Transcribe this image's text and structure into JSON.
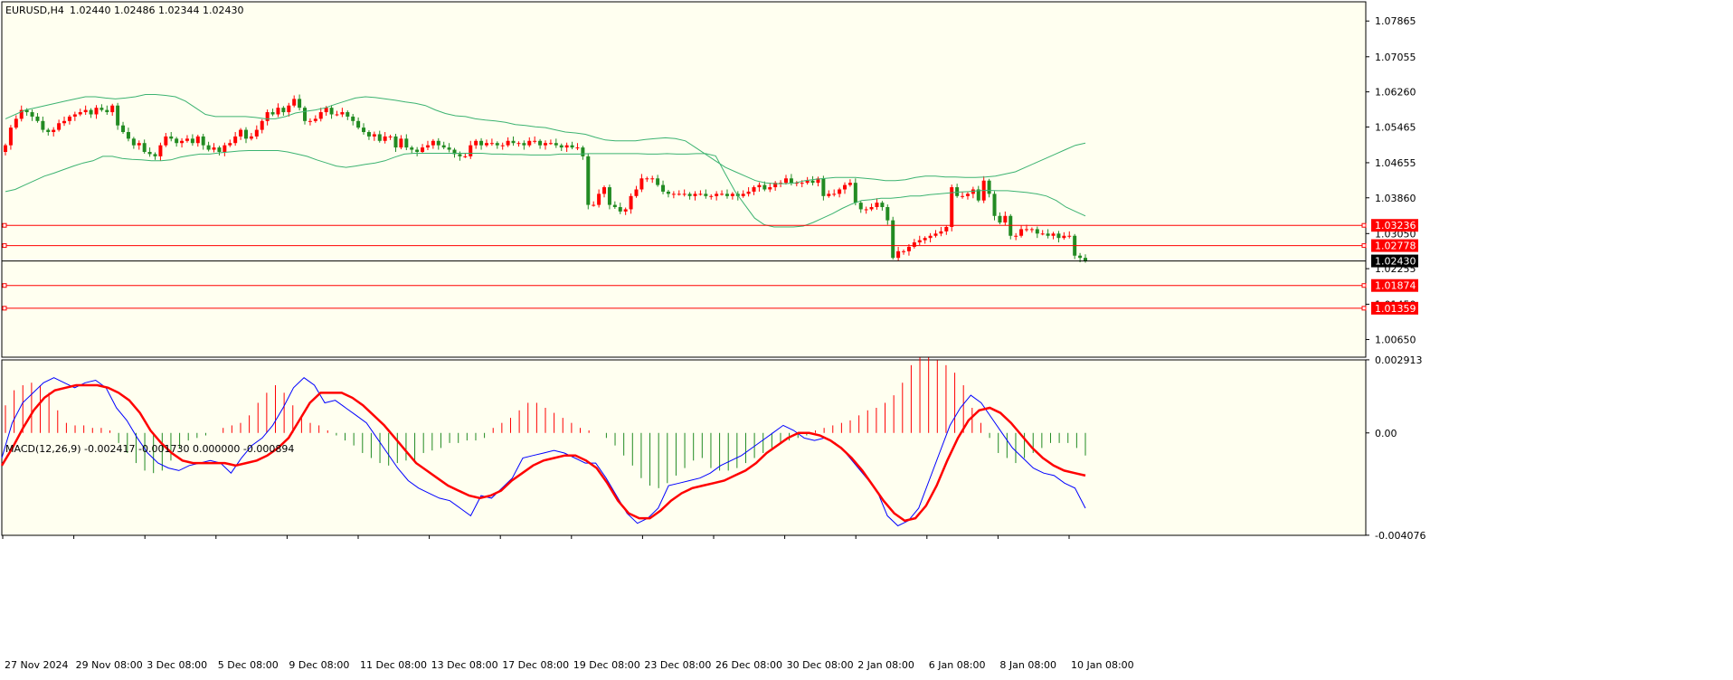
{
  "header": {
    "symbol": "EURUSD,H4",
    "ohlc": "1.02440 1.02486 1.02344 1.02430"
  },
  "macd_header": "MACD(12,26,9) -0.002417 -0.001730 0.000000 -0.000894",
  "colors": {
    "background": "#fffff0",
    "bull": "#ff0000",
    "bear": "#228b22",
    "bands": "#3cb371",
    "macd_line": "#0000ff",
    "signal_line": "#ff0000",
    "hline": "#ff0000",
    "current_line": "#000000"
  },
  "chart_data": [
    {
      "type": "candlestick",
      "title": "EURUSD,H4",
      "ylim": [
        1.0025,
        1.083
      ],
      "y_ticks": [
        "1.07865",
        "1.07055",
        "1.06260",
        "1.05465",
        "1.04655",
        "1.03860",
        "1.03050",
        "1.02255",
        "1.01450",
        "1.00650"
      ],
      "x_ticks": [
        "27 Nov 2024",
        "29 Nov 08:00",
        "3 Dec 08:00",
        "5 Dec 08:00",
        "9 Dec 08:00",
        "11 Dec 08:00",
        "13 Dec 08:00",
        "17 Dec 08:00",
        "19 Dec 08:00",
        "23 Dec 08:00",
        "26 Dec 08:00",
        "30 Dec 08:00",
        "2 Jan 08:00",
        "6 Jan 08:00",
        "8 Jan 08:00",
        "10 Jan 08:00"
      ],
      "last_price": "1.02430",
      "horizontal_levels": [
        "1.03236",
        "1.02778",
        "1.01874",
        "1.01359"
      ],
      "close_series": [
        1.0505,
        1.0545,
        1.0565,
        1.0585,
        1.058,
        1.057,
        1.056,
        1.054,
        1.0535,
        1.054,
        1.0555,
        1.056,
        1.057,
        1.0575,
        1.058,
        1.0585,
        1.0575,
        1.059,
        1.0585,
        1.058,
        1.0595,
        1.055,
        1.0535,
        1.052,
        1.0505,
        1.051,
        1.049,
        1.0485,
        1.048,
        1.0505,
        1.0525,
        1.052,
        1.051,
        1.0515,
        1.052,
        1.051,
        1.0525,
        1.0505,
        1.0495,
        1.05,
        1.049,
        1.0505,
        1.051,
        1.0525,
        1.054,
        1.052,
        1.0525,
        1.054,
        1.056,
        1.058,
        1.0575,
        1.059,
        1.058,
        1.0595,
        1.061,
        1.059,
        1.056,
        1.056,
        1.0565,
        1.058,
        1.059,
        1.0575,
        1.0575,
        1.058,
        1.057,
        1.056,
        1.0545,
        1.0535,
        1.0525,
        1.053,
        1.0515,
        1.0525,
        1.0525,
        1.05,
        1.052,
        1.05,
        1.0495,
        1.049,
        1.05,
        1.0505,
        1.0515,
        1.0505,
        1.05,
        1.0495,
        1.0485,
        1.048,
        1.048,
        1.0505,
        1.0515,
        1.0505,
        1.051,
        1.051,
        1.0505,
        1.0505,
        1.0515,
        1.051,
        1.051,
        1.0505,
        1.0515,
        1.0515,
        1.0505,
        1.051,
        1.051,
        1.0505,
        1.05,
        1.0505,
        1.05,
        1.05,
        1.048,
        1.037,
        1.037,
        1.0395,
        1.041,
        1.037,
        1.0365,
        1.0355,
        1.036,
        1.039,
        1.0405,
        1.043,
        1.043,
        1.043,
        1.0415,
        1.04,
        1.0395,
        1.0395,
        1.0395,
        1.0395,
        1.039,
        1.0395,
        1.0395,
        1.039,
        1.039,
        1.0395,
        1.0395,
        1.039,
        1.0395,
        1.039,
        1.0395,
        1.04,
        1.041,
        1.0415,
        1.0405,
        1.041,
        1.042,
        1.042,
        1.043,
        1.042,
        1.042,
        1.042,
        1.0425,
        1.042,
        1.043,
        1.039,
        1.0395,
        1.0395,
        1.0405,
        1.0415,
        1.042,
        1.0375,
        1.036,
        1.036,
        1.0365,
        1.0375,
        1.0365,
        1.0335,
        1.025,
        1.0265,
        1.0265,
        1.0275,
        1.0285,
        1.029,
        1.0295,
        1.03,
        1.0305,
        1.031,
        1.032,
        1.041,
        1.039,
        1.039,
        1.0395,
        1.0405,
        1.038,
        1.0425,
        1.0395,
        1.0345,
        1.033,
        1.0345,
        1.03,
        1.03,
        1.0315,
        1.0315,
        1.0315,
        1.0305,
        1.0305,
        1.03,
        1.0305,
        1.0295,
        1.03,
        1.03,
        1.0255,
        1.025,
        1.0243
      ],
      "band_upper": [
        1.0565,
        1.0575,
        1.0585,
        1.059,
        1.0595,
        1.06,
        1.0605,
        1.061,
        1.0615,
        1.0615,
        1.0612,
        1.061,
        1.0612,
        1.0615,
        1.062,
        1.062,
        1.0618,
        1.0615,
        1.0605,
        1.059,
        1.0575,
        1.057,
        1.057,
        1.057,
        1.057,
        1.0568,
        1.0565,
        1.0565,
        1.057,
        1.0578,
        1.0582,
        1.0585,
        1.059,
        1.0598,
        1.0605,
        1.0612,
        1.0615,
        1.0613,
        1.061,
        1.0607,
        1.0603,
        1.06,
        1.0595,
        1.0585,
        1.0577,
        1.0572,
        1.057,
        1.0565,
        1.0562,
        1.056,
        1.0557,
        1.0552,
        1.055,
        1.0547,
        1.0545,
        1.054,
        1.0535,
        1.0533,
        1.053,
        1.0523,
        1.0517,
        1.0515,
        1.0515,
        1.0515,
        1.0518,
        1.052,
        1.0522,
        1.052,
        1.0515,
        1.05,
        1.0485,
        1.047,
        1.0455,
        1.0445,
        1.0435,
        1.0425,
        1.042,
        1.0418,
        1.0418,
        1.042,
        1.0425,
        1.0428,
        1.043,
        1.0432,
        1.0432,
        1.0432,
        1.043,
        1.0428,
        1.0425,
        1.0425,
        1.0427,
        1.0432,
        1.0435,
        1.0435,
        1.0433,
        1.0433,
        1.0432,
        1.0432,
        1.0433,
        1.0435,
        1.044,
        1.0445,
        1.0455,
        1.0465,
        1.0475,
        1.0485,
        1.0495,
        1.0505,
        1.051
      ],
      "band_lower": [
        1.04,
        1.0405,
        1.0415,
        1.0425,
        1.0435,
        1.0442,
        1.045,
        1.0458,
        1.0465,
        1.047,
        1.048,
        1.048,
        1.0475,
        1.0473,
        1.0472,
        1.047,
        1.047,
        1.0472,
        1.0478,
        1.0482,
        1.0485,
        1.0485,
        1.0488,
        1.049,
        1.0492,
        1.0493,
        1.0493,
        1.0493,
        1.0493,
        1.049,
        1.0485,
        1.048,
        1.0472,
        1.0465,
        1.0458,
        1.0455,
        1.0458,
        1.0462,
        1.0465,
        1.047,
        1.0478,
        1.0485,
        1.0487,
        1.0487,
        1.0487,
        1.0487,
        1.0487,
        1.0487,
        1.0487,
        1.0487,
        1.0485,
        1.0485,
        1.0484,
        1.0484,
        1.0483,
        1.0483,
        1.0483,
        1.0485,
        1.0485,
        1.0485,
        1.0486,
        1.0486,
        1.0486,
        1.0486,
        1.0486,
        1.0486,
        1.0485,
        1.0485,
        1.0486,
        1.0485,
        1.0485,
        1.0486,
        1.0486,
        1.0481,
        1.044,
        1.04,
        1.037,
        1.034,
        1.0325,
        1.032,
        1.032,
        1.032,
        1.0322,
        1.033,
        1.034,
        1.035,
        1.0362,
        1.0372,
        1.038,
        1.0382,
        1.0385,
        1.0385,
        1.0387,
        1.039,
        1.039,
        1.0393,
        1.0395,
        1.0397,
        1.0399,
        1.04,
        1.0402,
        1.0403,
        1.0402,
        1.0402,
        1.04,
        1.0398,
        1.0395,
        1.039,
        1.038,
        1.0365,
        1.0355,
        1.0345
      ]
    },
    {
      "type": "line",
      "title": "MACD(12,26,9) -0.002417 -0.001730 0.000000 -0.000894",
      "ylim": [
        -0.00408,
        0.00291
      ],
      "y_ticks": [
        "0.002913",
        "0.00",
        "-0.004076"
      ],
      "series": [
        {
          "name": "MACD",
          "values": [
            -0.001,
            0.0004,
            0.0012,
            0.0016,
            0.002,
            0.0022,
            0.002,
            0.0018,
            0.002,
            0.0021,
            0.0018,
            0.001,
            0.0005,
            -0.0002,
            -0.0008,
            -0.0012,
            -0.0014,
            -0.0015,
            -0.0013,
            -0.0012,
            -0.0011,
            -0.0012,
            -0.0016,
            -0.001,
            -0.0005,
            -0.0002,
            0.0003,
            0.001,
            0.0018,
            0.0022,
            0.0019,
            0.0012,
            0.0013,
            0.001,
            0.0007,
            0.0004,
            -0.0002,
            -0.0008,
            -0.0014,
            -0.0019,
            -0.0022,
            -0.0024,
            -0.0026,
            -0.0027,
            -0.003,
            -0.0033,
            -0.0025,
            -0.0026,
            -0.0022,
            -0.0018,
            -0.001,
            -0.0009,
            -0.0008,
            -0.0007,
            -0.0008,
            -0.001,
            -0.0012,
            -0.0012,
            -0.0018,
            -0.0025,
            -0.0032,
            -0.0036,
            -0.0034,
            -0.003,
            -0.0021,
            -0.002,
            -0.0019,
            -0.0018,
            -0.0016,
            -0.0013,
            -0.0011,
            -0.0009,
            -0.0006,
            -0.0003,
            0.0,
            0.0003,
            0.0001,
            -0.0002,
            -0.0003,
            -0.0002,
            -0.0004,
            -0.0008,
            -0.0013,
            -0.0018,
            -0.0023,
            -0.0033,
            -0.0037,
            -0.0035,
            -0.003,
            -0.0019,
            -0.0008,
            0.0003,
            0.001,
            0.0015,
            0.0012,
            0.0006,
            0.0,
            -0.0006,
            -0.001,
            -0.0014,
            -0.0016,
            -0.0017,
            -0.002,
            -0.0022,
            -0.003
          ]
        },
        {
          "name": "Signal",
          "values": [
            -0.0013,
            -0.0006,
            0.0002,
            0.0009,
            0.0014,
            0.0017,
            0.0018,
            0.0019,
            0.0019,
            0.0019,
            0.0018,
            0.0016,
            0.0013,
            0.0008,
            0.0001,
            -0.0004,
            -0.0008,
            -0.0011,
            -0.0012,
            -0.0012,
            -0.0012,
            -0.0012,
            -0.0013,
            -0.0012,
            -0.0011,
            -0.0009,
            -0.0006,
            -0.0002,
            0.0005,
            0.0012,
            0.0016,
            0.0016,
            0.0016,
            0.0014,
            0.0011,
            0.0007,
            0.0003,
            -0.0002,
            -0.0007,
            -0.0012,
            -0.0015,
            -0.0018,
            -0.0021,
            -0.0023,
            -0.0025,
            -0.0026,
            -0.0025,
            -0.0023,
            -0.0019,
            -0.0016,
            -0.0013,
            -0.0011,
            -0.001,
            -0.0009,
            -0.0009,
            -0.0011,
            -0.0014,
            -0.002,
            -0.0027,
            -0.0032,
            -0.0034,
            -0.0034,
            -0.0031,
            -0.0027,
            -0.0024,
            -0.0022,
            -0.0021,
            -0.002,
            -0.0019,
            -0.0017,
            -0.0015,
            -0.0012,
            -0.0008,
            -0.0005,
            -0.0002,
            0.0,
            0.0,
            -0.0001,
            -0.0003,
            -0.0006,
            -0.001,
            -0.0015,
            -0.0021,
            -0.0027,
            -0.0032,
            -0.0035,
            -0.0034,
            -0.0029,
            -0.0021,
            -0.0011,
            -0.0002,
            0.0005,
            0.0009,
            0.001,
            0.0008,
            0.0004,
            -0.0001,
            -0.0006,
            -0.001,
            -0.0013,
            -0.0015,
            -0.0016,
            -0.0017
          ]
        },
        {
          "name": "Histogram",
          "values": [
            0.0011,
            0.0017,
            0.0019,
            0.002,
            0.0019,
            0.0016,
            0.0009,
            0.0004,
            0.0003,
            0.0003,
            0.0002,
            0.0002,
            0.0001,
            -0.0004,
            -0.0008,
            -0.0012,
            -0.0015,
            -0.0016,
            -0.0015,
            -0.0011,
            -0.0006,
            -0.0003,
            -0.0002,
            -0.0001,
            0.0,
            0.0002,
            0.0003,
            0.0004,
            0.0007,
            0.0012,
            0.0016,
            0.0019,
            0.0016,
            0.0011,
            0.0006,
            0.0004,
            0.0003,
            0.0001,
            -0.0001,
            -0.0003,
            -0.0005,
            -0.0008,
            -0.001,
            -0.0012,
            -0.0013,
            -0.0012,
            -0.0011,
            -0.0011,
            -0.0008,
            -0.0007,
            -0.0006,
            -0.0004,
            -0.0004,
            -0.0003,
            -0.0003,
            -0.0002,
            0.0002,
            0.0004,
            0.0006,
            0.0009,
            0.0012,
            0.0012,
            0.001,
            0.0008,
            0.0006,
            0.0004,
            0.0002,
            0.0001,
            0.0,
            -0.0002,
            -0.0005,
            -0.0009,
            -0.0013,
            -0.0018,
            -0.0021,
            -0.0022,
            -0.002,
            -0.0017,
            -0.0014,
            -0.0011,
            -0.001,
            -0.0014,
            -0.0015,
            -0.0015,
            -0.0014,
            -0.0012,
            -0.001,
            -0.0008,
            -0.0006,
            -0.0004,
            -0.0003,
            -0.0002,
            -0.0001,
            0.0001,
            0.0002,
            0.0003,
            0.0004,
            0.0005,
            0.0007,
            0.0009,
            0.001,
            0.0012,
            0.0015,
            0.002,
            0.0027,
            0.003,
            0.003,
            0.0029,
            0.0027,
            0.0024,
            0.0019,
            0.001,
            0.0004,
            -0.0002,
            -0.0008,
            -0.001,
            -0.0012,
            -0.001,
            -0.0008,
            -0.0006,
            -0.0004,
            -0.0004,
            -0.0004,
            -0.0006,
            -0.0009
          ]
        }
      ]
    }
  ]
}
